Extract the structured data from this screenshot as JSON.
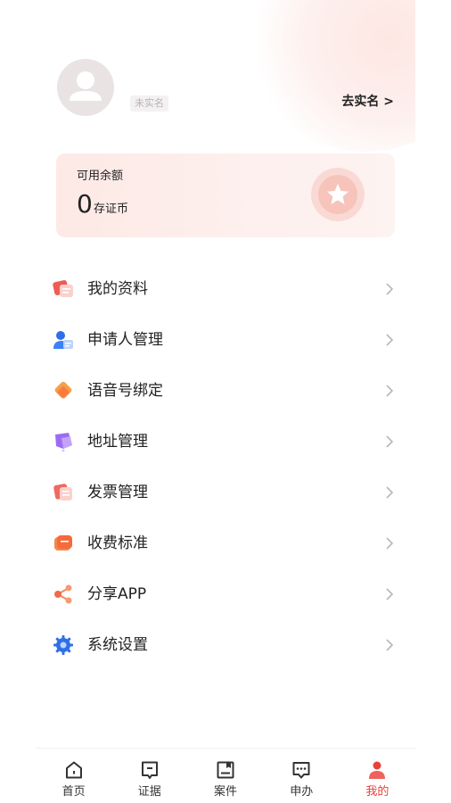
{
  "profile": {
    "verify_status": "未实名",
    "verify_link": "去实名 >"
  },
  "balance": {
    "label": "可用余额",
    "amount": "0",
    "unit": "存证币"
  },
  "menu": [
    {
      "label": "我的资料",
      "icon": "profile-card-icon"
    },
    {
      "label": "申请人管理",
      "icon": "applicant-icon"
    },
    {
      "label": "语音号绑定",
      "icon": "voice-bind-icon"
    },
    {
      "label": "地址管理",
      "icon": "address-icon"
    },
    {
      "label": "发票管理",
      "icon": "invoice-icon"
    },
    {
      "label": "收费标准",
      "icon": "fee-standard-icon"
    },
    {
      "label": "分享APP",
      "icon": "share-icon"
    },
    {
      "label": "系统设置",
      "icon": "settings-icon"
    }
  ],
  "nav": [
    {
      "label": "首页",
      "icon": "home-icon"
    },
    {
      "label": "证据",
      "icon": "evidence-icon"
    },
    {
      "label": "案件",
      "icon": "case-icon"
    },
    {
      "label": "申办",
      "icon": "apply-icon"
    },
    {
      "label": "我的",
      "icon": "me-icon",
      "active": true
    }
  ],
  "colors": {
    "accent": "#e8413b",
    "card_bg": "#fdece9"
  }
}
